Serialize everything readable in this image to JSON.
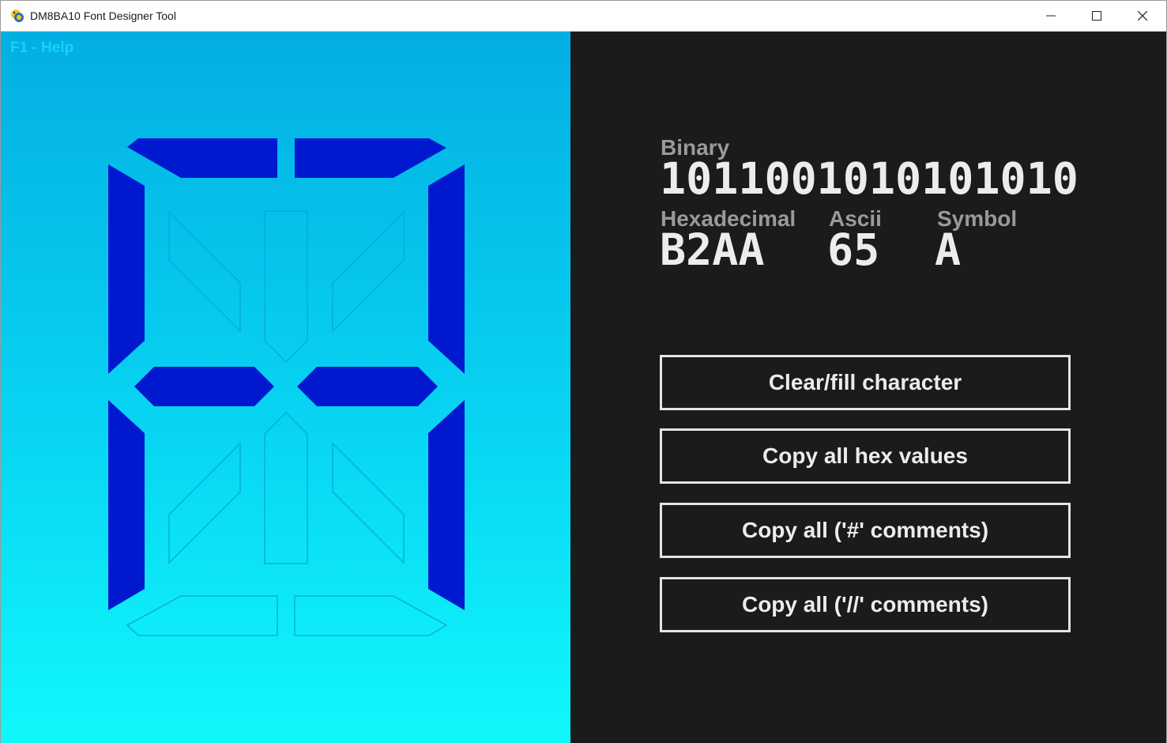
{
  "window": {
    "title": "DM8BA10 Font Designer Tool"
  },
  "help": {
    "label": "F1 - Help"
  },
  "display": {
    "on_color": "#0019cf",
    "segments": [
      {
        "id": "top-left",
        "on": true
      },
      {
        "id": "top-right",
        "on": true
      },
      {
        "id": "upper-left",
        "on": true
      },
      {
        "id": "upper-diag-left",
        "on": false
      },
      {
        "id": "upper-center",
        "on": false
      },
      {
        "id": "upper-diag-right",
        "on": false
      },
      {
        "id": "upper-right",
        "on": true
      },
      {
        "id": "middle-left",
        "on": true
      },
      {
        "id": "middle-right",
        "on": true
      },
      {
        "id": "lower-left",
        "on": true
      },
      {
        "id": "lower-diag-left",
        "on": false
      },
      {
        "id": "lower-center",
        "on": false
      },
      {
        "id": "lower-diag-right",
        "on": false
      },
      {
        "id": "lower-right",
        "on": true
      },
      {
        "id": "bottom-left",
        "on": false
      },
      {
        "id": "bottom-right",
        "on": false
      }
    ]
  },
  "info": {
    "binary_label": "Binary",
    "binary_value": "1011001010101010",
    "hex_label": "Hexadecimal",
    "hex_value": "B2AA",
    "ascii_label": "Ascii",
    "ascii_value": "65",
    "symbol_label": "Symbol",
    "symbol_value": "A"
  },
  "buttons": {
    "clear_fill": "Clear/fill character",
    "copy_hex": "Copy all hex values",
    "copy_hash_comments": "Copy all ('#' comments)",
    "copy_slash_comments": "Copy all ('//' comments)"
  }
}
